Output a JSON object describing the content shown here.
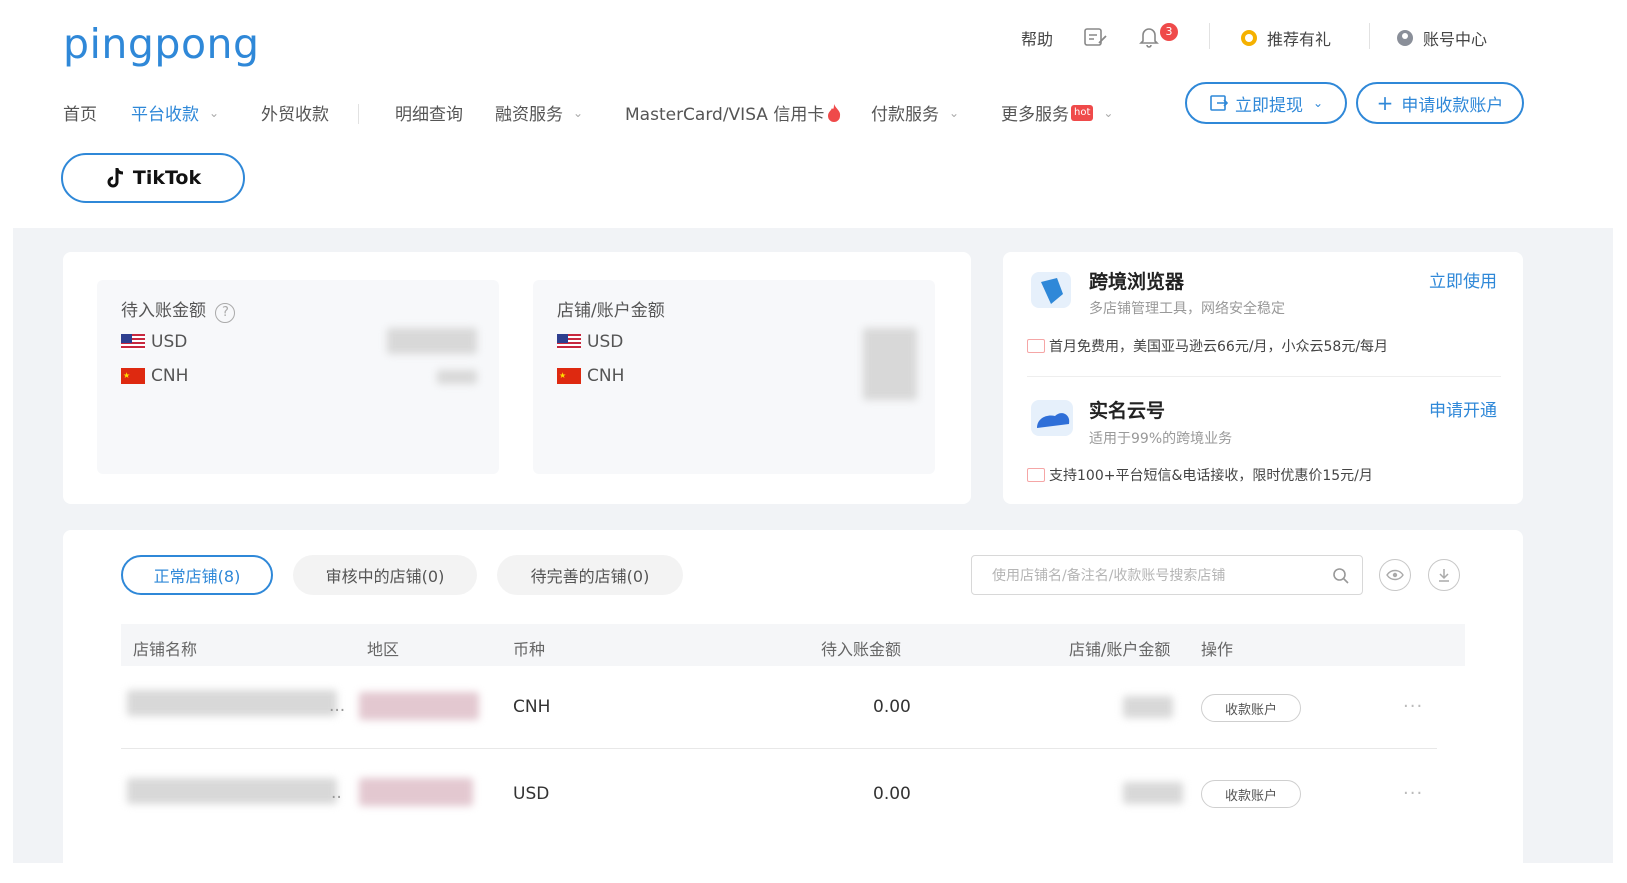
{
  "logo": "pingpong",
  "header": {
    "help": "帮助",
    "notification_count": "3",
    "referral": "推荐有礼",
    "account_center": "账号中心"
  },
  "nav": [
    {
      "label": "首页"
    },
    {
      "label": "平台收款"
    },
    {
      "label": "外贸收款"
    },
    {
      "label": "明细查询"
    },
    {
      "label": "融资服务"
    },
    {
      "label": "MasterCard/VISA 信用卡"
    },
    {
      "label": "付款服务"
    },
    {
      "label": "更多服务"
    }
  ],
  "nav_hot_badge": "hot",
  "actions": {
    "withdraw": "立即提现",
    "apply_account": "申请收款账户"
  },
  "platform_tab": "TikTok",
  "balances": {
    "pending_title": "待入账金额",
    "store_title": "店铺/账户金额",
    "usd": "USD",
    "cnh": "CNH"
  },
  "promos": [
    {
      "title": "跨境浏览器",
      "subtitle": "多店铺管理工具，网络安全稳定",
      "link": "立即使用",
      "note": "首月免费用，美国亚马逊云66元/月，小众云58元/每月"
    },
    {
      "title": "实名云号",
      "subtitle": "适用于99%的跨境业务",
      "link": "申请开通",
      "note": "支持100+平台短信&电话接收，限时优惠价15元/月"
    }
  ],
  "store_tabs": [
    "正常店铺(8)",
    "审核中的店铺(0)",
    "待完善的店铺(0)"
  ],
  "search": {
    "placeholder": "使用店铺名/备注名/收款账号搜索店铺"
  },
  "table": {
    "headers": [
      "店铺名称",
      "地区",
      "币种",
      "待入账金额",
      "店铺/账户金额",
      "操作"
    ],
    "rows": [
      {
        "currency": "CNH",
        "pending": "0.00",
        "action": "收款账户"
      },
      {
        "currency": "USD",
        "pending": "0.00",
        "action": "收款账户"
      }
    ]
  },
  "colors": {
    "accent": "#2f88d8",
    "badge": "#ef4a4a"
  }
}
